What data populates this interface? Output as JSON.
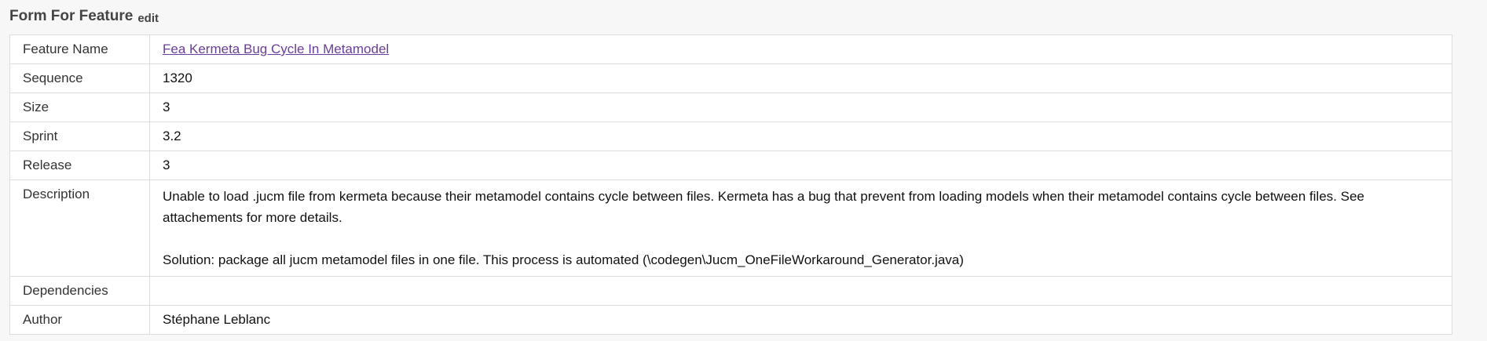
{
  "header": {
    "title": "Form For Feature",
    "edit_label": "edit"
  },
  "rows": {
    "feature_name": {
      "label": "Feature Name",
      "value": "Fea Kermeta Bug Cycle In Metamodel"
    },
    "sequence": {
      "label": "Sequence",
      "value": "1320"
    },
    "size": {
      "label": "Size",
      "value": "3"
    },
    "sprint": {
      "label": "Sprint",
      "value": "3.2"
    },
    "release": {
      "label": "Release",
      "value": "3"
    },
    "description": {
      "label": "Description",
      "paragraph1": "Unable to load .jucm file from kermeta because their metamodel contains cycle between files. Kermeta has a bug that prevent from loading models when their metamodel contains cycle between files. See attachements for more details.",
      "paragraph2": "Solution: package all jucm metamodel files in one file. This process is automated (\\codegen\\Jucm_OneFileWorkaround_Generator.java)"
    },
    "dependencies": {
      "label": "Dependencies",
      "value": ""
    },
    "author": {
      "label": "Author",
      "value": "Stéphane Leblanc"
    }
  },
  "colors": {
    "link": "#6a3d9a",
    "border": "#dddddd",
    "page_background": "#f7f7f7"
  }
}
